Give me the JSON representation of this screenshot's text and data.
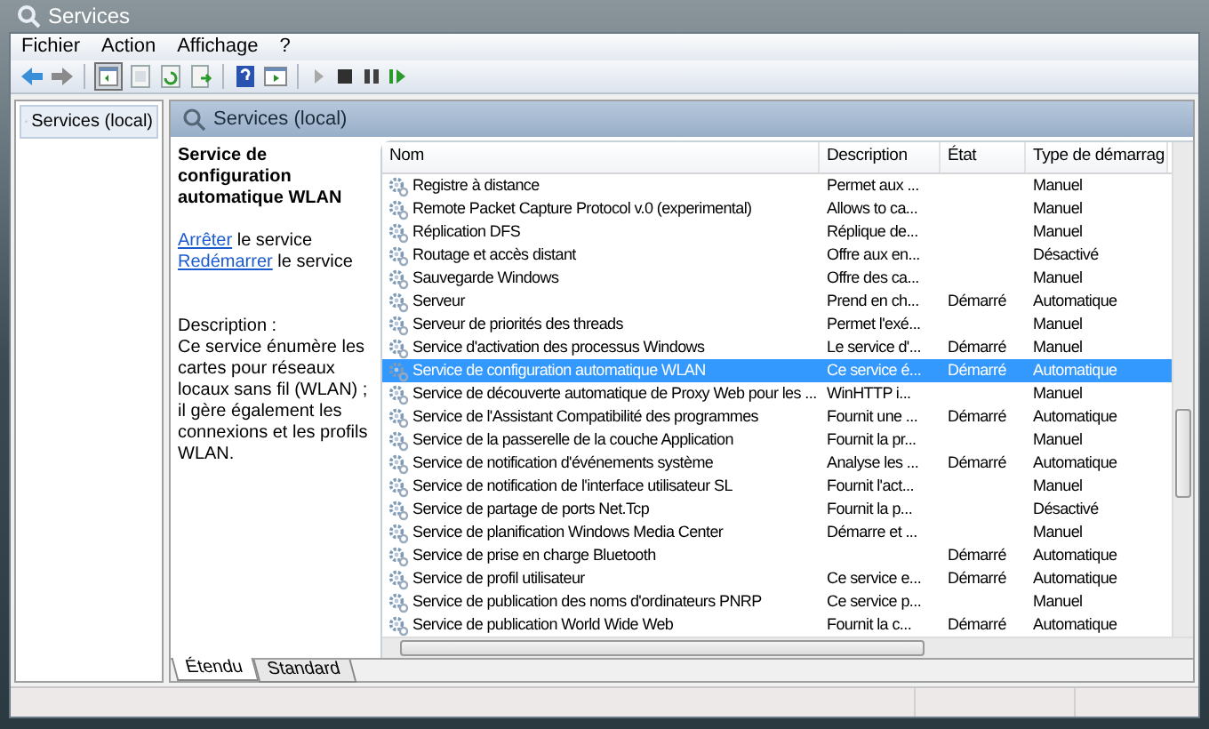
{
  "window": {
    "title": "Services"
  },
  "menu": [
    "Fichier",
    "Action",
    "Affichage",
    "?"
  ],
  "tree": [
    {
      "label": "Services (local)",
      "selected": true
    }
  ],
  "pane_header": "Services (local)",
  "details": {
    "title": "Service de configuration automatique WLAN",
    "actions": [
      {
        "link": "Arrêter",
        "text": " le service"
      },
      {
        "link": "Redémarrer",
        "text": " le service"
      }
    ],
    "description_label": "Description :",
    "description": "Ce service énumère les cartes pour réseaux locaux sans fil (WLAN) ; il gère également les connexions et les profils WLAN."
  },
  "table": {
    "columns": [
      "Nom",
      "Description",
      "État",
      "Type de démarrag"
    ],
    "rows": [
      {
        "name": "Registre à distance",
        "description": "Permet aux ...",
        "state": "",
        "startup": "Manuel",
        "selected": false
      },
      {
        "name": "Remote Packet Capture Protocol v.0 (experimental)",
        "description": "Allows to ca...",
        "state": "",
        "startup": "Manuel",
        "selected": false
      },
      {
        "name": "Réplication DFS",
        "description": "Réplique de...",
        "state": "",
        "startup": "Manuel",
        "selected": false
      },
      {
        "name": "Routage et accès distant",
        "description": "Offre aux en...",
        "state": "",
        "startup": "Désactivé",
        "selected": false
      },
      {
        "name": "Sauvegarde Windows",
        "description": "Offre des ca...",
        "state": "",
        "startup": "Manuel",
        "selected": false
      },
      {
        "name": "Serveur",
        "description": "Prend en ch...",
        "state": "Démarré",
        "startup": "Automatique",
        "selected": false
      },
      {
        "name": "Serveur de priorités des threads",
        "description": "Permet l'exé...",
        "state": "",
        "startup": "Manuel",
        "selected": false
      },
      {
        "name": "Service d'activation des processus Windows",
        "description": "Le service d'...",
        "state": "Démarré",
        "startup": "Manuel",
        "selected": false
      },
      {
        "name": "Service de configuration automatique WLAN",
        "description": "Ce service é...",
        "state": "Démarré",
        "startup": "Automatique",
        "selected": true
      },
      {
        "name": "Service de découverte automatique de Proxy Web pour les ...",
        "description": "WinHTTP i...",
        "state": "",
        "startup": "Manuel",
        "selected": false
      },
      {
        "name": "Service de l'Assistant Compatibilité des programmes",
        "description": "Fournit une ...",
        "state": "Démarré",
        "startup": "Automatique",
        "selected": false
      },
      {
        "name": "Service de la passerelle de la couche Application",
        "description": "Fournit la pr...",
        "state": "",
        "startup": "Manuel",
        "selected": false
      },
      {
        "name": "Service de notification d'événements système",
        "description": "Analyse les ...",
        "state": "Démarré",
        "startup": "Automatique",
        "selected": false
      },
      {
        "name": "Service de notification de l'interface utilisateur SL",
        "description": "Fournit l'act...",
        "state": "",
        "startup": "Manuel",
        "selected": false
      },
      {
        "name": "Service de partage de ports Net.Tcp",
        "description": "Fournit la p...",
        "state": "",
        "startup": "Désactivé",
        "selected": false
      },
      {
        "name": "Service de planification Windows Media Center",
        "description": "Démarre et ...",
        "state": "",
        "startup": "Manuel",
        "selected": false
      },
      {
        "name": "Service de prise en charge Bluetooth",
        "description": "",
        "state": "Démarré",
        "startup": "Automatique",
        "selected": false
      },
      {
        "name": "Service de profil utilisateur",
        "description": "Ce service e...",
        "state": "Démarré",
        "startup": "Automatique",
        "selected": false
      },
      {
        "name": "Service de publication des noms d'ordinateurs PNRP",
        "description": "Ce service p...",
        "state": "",
        "startup": "Manuel",
        "selected": false
      },
      {
        "name": "Service de publication World Wide Web",
        "description": "Fournit la c...",
        "state": "Démarré",
        "startup": "Automatique",
        "selected": false
      }
    ]
  },
  "view_tabs": [
    {
      "label": "Étendu",
      "selected": true
    },
    {
      "label": "Standard",
      "selected": false
    }
  ]
}
